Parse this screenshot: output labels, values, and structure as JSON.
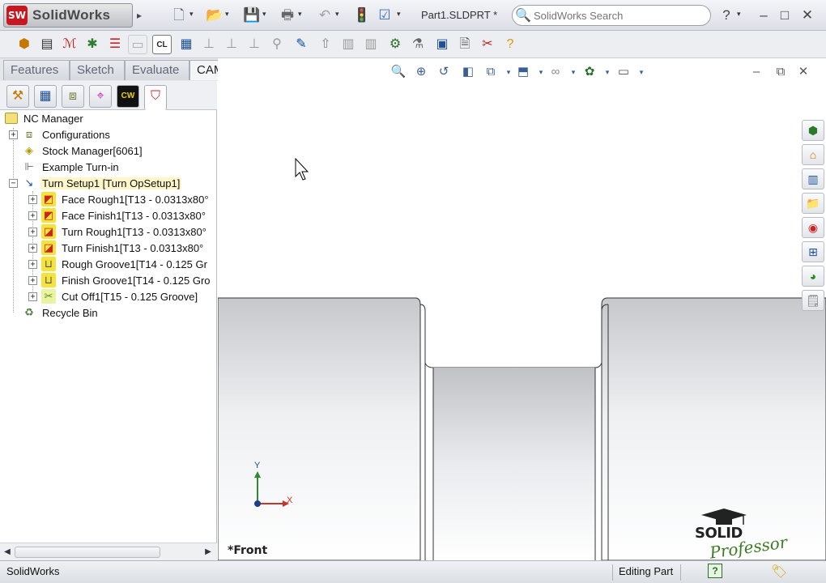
{
  "app": {
    "logo_text": "SolidWorks",
    "logo_badge": "SW"
  },
  "titlebar": {
    "document": "Part1.SLDPRT *",
    "search_placeholder": "SolidWorks Search",
    "icons": [
      "new-icon",
      "open-icon",
      "save-icon",
      "print-icon",
      "undo-icon",
      "rebuild-icon",
      "options-icon"
    ],
    "window_buttons": {
      "help": "?",
      "minimize": "–",
      "restore": "□",
      "close": "✕"
    }
  },
  "tabs": [
    {
      "label": "Features"
    },
    {
      "label": "Sketch"
    },
    {
      "label": "Evaluate"
    },
    {
      "label": "CAMWorks",
      "active": true
    }
  ],
  "tree": {
    "root": "NC Manager",
    "items": [
      {
        "label": "Configurations"
      },
      {
        "label": "Stock Manager[6061]"
      },
      {
        "label": "Example Turn-in"
      },
      {
        "label": "Turn Setup1 [Turn OpSetup1]"
      },
      {
        "label": "Face Rough1[T13 - 0.0313x80°"
      },
      {
        "label": "Face Finish1[T13 - 0.0313x80°"
      },
      {
        "label": "Turn Rough1[T13 - 0.0313x80°"
      },
      {
        "label": "Turn Finish1[T13 - 0.0313x80°"
      },
      {
        "label": "Rough Groove1[T14 - 0.125 Gr"
      },
      {
        "label": "Finish Groove1[T14 - 0.125 Gro"
      },
      {
        "label": "Cut Off1[T15 - 0.125 Groove]"
      },
      {
        "label": "Recycle Bin"
      }
    ]
  },
  "graphics": {
    "view_label": "*Front",
    "triad_x": "X",
    "triad_y": "Y",
    "watermark_line1": "SOLID",
    "watermark_line2": "Professor",
    "window_buttons": {
      "minimize": "–",
      "restore": "⧉",
      "close": "✕"
    }
  },
  "statusbar": {
    "app": "SolidWorks",
    "mode": "Editing Part",
    "help": "?"
  },
  "colors": {
    "titlebar": "#dcdfe6",
    "accent_red": "#c8171e",
    "selection": "#fdf6c8",
    "part_gray": "#c9cbcf"
  }
}
